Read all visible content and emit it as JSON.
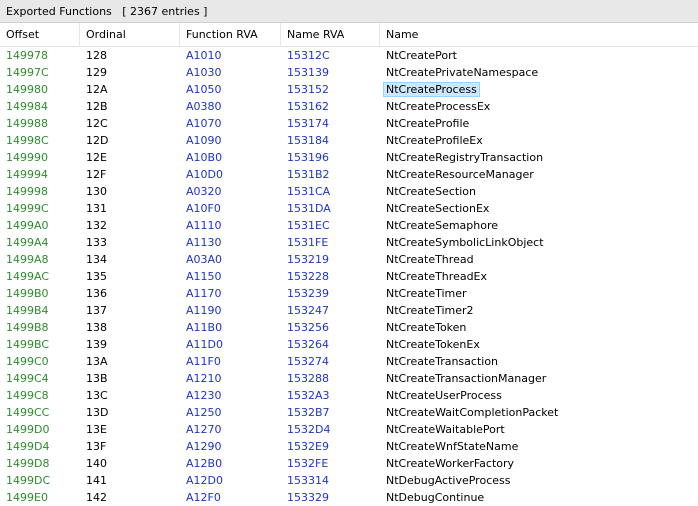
{
  "panel": {
    "title": "Exported Functions   [ 2367 entries ]"
  },
  "columns": [
    "Offset",
    "Ordinal",
    "Function RVA",
    "Name RVA",
    "Name"
  ],
  "selected_index": 2,
  "rows": [
    [
      "149978",
      "128",
      "A1010",
      "15312C",
      "NtCreatePort"
    ],
    [
      "14997C",
      "129",
      "A1030",
      "153139",
      "NtCreatePrivateNamespace"
    ],
    [
      "149980",
      "12A",
      "A1050",
      "153152",
      "NtCreateProcess"
    ],
    [
      "149984",
      "12B",
      "A0380",
      "153162",
      "NtCreateProcessEx"
    ],
    [
      "149988",
      "12C",
      "A1070",
      "153174",
      "NtCreateProfile"
    ],
    [
      "14998C",
      "12D",
      "A1090",
      "153184",
      "NtCreateProfileEx"
    ],
    [
      "149990",
      "12E",
      "A10B0",
      "153196",
      "NtCreateRegistryTransaction"
    ],
    [
      "149994",
      "12F",
      "A10D0",
      "1531B2",
      "NtCreateResourceManager"
    ],
    [
      "149998",
      "130",
      "A0320",
      "1531CA",
      "NtCreateSection"
    ],
    [
      "14999C",
      "131",
      "A10F0",
      "1531DA",
      "NtCreateSectionEx"
    ],
    [
      "1499A0",
      "132",
      "A1110",
      "1531EC",
      "NtCreateSemaphore"
    ],
    [
      "1499A4",
      "133",
      "A1130",
      "1531FE",
      "NtCreateSymbolicLinkObject"
    ],
    [
      "1499A8",
      "134",
      "A03A0",
      "153219",
      "NtCreateThread"
    ],
    [
      "1499AC",
      "135",
      "A1150",
      "153228",
      "NtCreateThreadEx"
    ],
    [
      "1499B0",
      "136",
      "A1170",
      "153239",
      "NtCreateTimer"
    ],
    [
      "1499B4",
      "137",
      "A1190",
      "153247",
      "NtCreateTimer2"
    ],
    [
      "1499B8",
      "138",
      "A11B0",
      "153256",
      "NtCreateToken"
    ],
    [
      "1499BC",
      "139",
      "A11D0",
      "153264",
      "NtCreateTokenEx"
    ],
    [
      "1499C0",
      "13A",
      "A11F0",
      "153274",
      "NtCreateTransaction"
    ],
    [
      "1499C4",
      "13B",
      "A1210",
      "153288",
      "NtCreateTransactionManager"
    ],
    [
      "1499C8",
      "13C",
      "A1230",
      "1532A3",
      "NtCreateUserProcess"
    ],
    [
      "1499CC",
      "13D",
      "A1250",
      "1532B7",
      "NtCreateWaitCompletionPacket"
    ],
    [
      "1499D0",
      "13E",
      "A1270",
      "1532D4",
      "NtCreateWaitablePort"
    ],
    [
      "1499D4",
      "13F",
      "A1290",
      "1532E9",
      "NtCreateWnfStateName"
    ],
    [
      "1499D8",
      "140",
      "A12B0",
      "1532FE",
      "NtCreateWorkerFactory"
    ],
    [
      "1499DC",
      "141",
      "A12D0",
      "153314",
      "NtDebugActiveProcess"
    ],
    [
      "1499E0",
      "142",
      "A12F0",
      "153329",
      "NtDebugContinue"
    ]
  ],
  "colors": {
    "offset": "#2e8b2e",
    "rva": "#1f35c8",
    "selection": "#cce8ff"
  }
}
